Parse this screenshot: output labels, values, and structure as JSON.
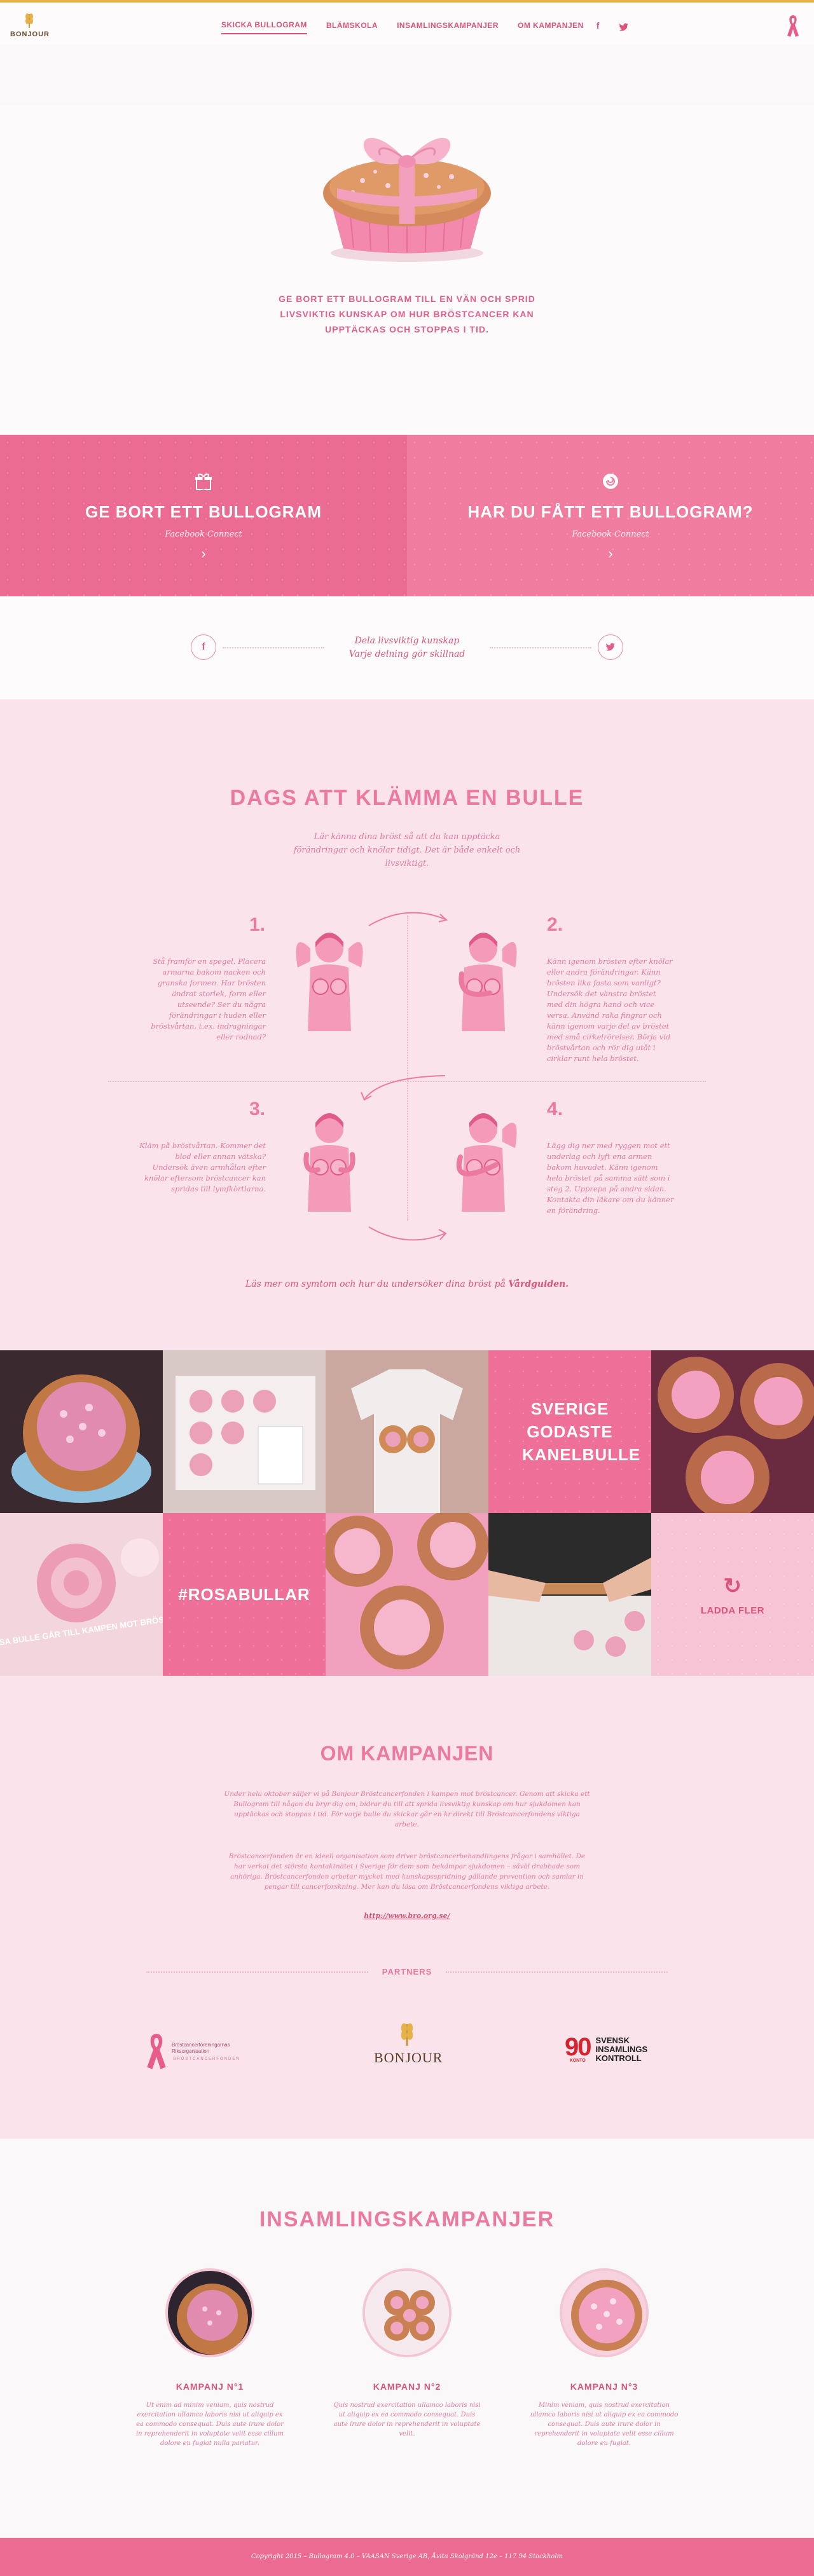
{
  "nav": {
    "logo_text": "BONJOUR",
    "items": [
      "SKICKA BULLOGRAM",
      "BLÄMSKOLA",
      "INSAMLINGSKAMPANJER",
      "OM KAMPANJEN"
    ],
    "facebook_glyph": "f",
    "twitter_glyph": "t"
  },
  "hero": {
    "text": "GE BORT ETT BULLOGRAM TILL EN VÄN OCH SPRID LIVSVIKTIG KUNSKAP OM HUR BRÖSTCANCER KAN UPPTÄCKAS OCH STOPPAS I TID."
  },
  "cta": [
    {
      "title": "GE BORT ETT BULLOGRAM",
      "sub": "Facebook Connect",
      "icon": "gift-icon"
    },
    {
      "title": "HAR DU FÅTT ETT BULLOGRAM?",
      "sub": "Facebook Connect",
      "icon": "bun-icon"
    }
  ],
  "share": {
    "line1": "Dela livsviktig kunskap",
    "line2": "Varje delning gör skillnad"
  },
  "squeeze": {
    "title": "DAGS ATT KLÄMMA EN BULLE",
    "intro": "Lär känna dina bröst så att du kan upptäcka förändringar och knölar tidigt. Det är både enkelt och livsviktigt.",
    "steps": [
      {
        "num": "1.",
        "text": "Stå framför en spegel. Placera armarna bakom nacken och granska formen. Har brösten ändrat storlek, form eller utseende? Ser du några förändringar i huden eller bröstvårtan, t.ex. indragningar eller rodnad?"
      },
      {
        "num": "2.",
        "text": "Känn igenom brösten efter knölar eller andra förändringar. Känn brösten lika fasta som vanligt? Undersök det vänstra bröstet med din högra hand och vice versa. Använd raka fingrar och känn igenom varje del av bröstet med små cirkelrörelser. Börja vid bröstvårtan och rör dig utåt i cirklar runt hela bröstet."
      },
      {
        "num": "3.",
        "text": "Kläm på bröstvårtan. Kommer det blod eller annan vätska? Undersök även armhålan efter knölar eftersom bröstcancer kan spridas till lymfkörtlarna."
      },
      {
        "num": "4.",
        "text": "Lägg dig ner med ryggen mot ett underlag och lyft ena armen bakom huvudet. Känn igenom hela bröstet på samma sätt som i steg 2. Upprepa på andra sidan. Kontakta din läkare om du känner en förändring."
      }
    ],
    "guide_pre": "Läs mer om symtom och hur du undersöker dina bröst på",
    "guide_link": "Vårdguiden."
  },
  "gallery": {
    "tile_text_1": "SVERIGE GODASTE KANELBULLE",
    "tile_text_2": "#ROSABULLAR",
    "load_more": "LADDA FLER",
    "photo_caption": "VARJE ROSA BULLE GÅR TILL KAMPEN MOT BRÖSTCANCER"
  },
  "about": {
    "title": "OM KAMPANJEN",
    "p1": "Under hela oktober säljer vi på Bonjour Bröstcancerfonden i kampen mot bröstcancer. Genom att skicka ett Bullogram till någon du bryr dig om, bidrar du till att sprida livsviktig kunskap om hur sjukdomen kan upptäckas och stoppas i tid. För varje bulle du skickar går en kr direkt till Bröstcancerfondens viktiga arbete.",
    "p2": "Bröstcancerfonden är en ideell organisation som driver bröstcancerbehandlingens frågor i samhället. De har verkat det största kontaktnätet i Sverige för dem som bekämpar sjukdomen – såväl drabbade som anhöriga. Bröstcancerfonden arbetar mycket med kunskapsspridning gällande prevention och samlar in pengar till cancerforskning. Mer kan du läsa om Bröstcancerfondens viktiga arbete.",
    "link": "http://www.bro.org.se/",
    "partners_label": "PARTNERS",
    "partner1_name": "Bröstcancerföreningarnas Riksorganisation",
    "partner1_small": "BRÖSTCANCERFONDEN",
    "partner2_name": "BONJOUR",
    "partner3_num": "90",
    "partner3_konto": "KONTO",
    "partner3_name_1": "SVENSK",
    "partner3_name_2": "INSAMLINGS",
    "partner3_name_3": "KONTROLL"
  },
  "campaigns": {
    "title": "INSAMLINGSKAMPANJER",
    "items": [
      {
        "name": "KAMPANJ N°1",
        "text": "Ut enim ad minim veniam, quis nostrud exercitation ullamco laboris nisi ut aliquip ex ea commodo consequat. Duis aute irure dolor in reprehenderit in voluptate velit esse cillum dolore eu fugiat nulla pariatur."
      },
      {
        "name": "KAMPANJ N°2",
        "text": "Quis nostrud exercitation ullamco laboris nisi ut aliquip ex ea commodo consequat. Duis aute irure dolor in reprehenderit in voluptate velit."
      },
      {
        "name": "KAMPANJ N°3",
        "text": "Minim veniam, quis nostrud exercitation ullamco laboris nisi ut aliquip ex ea commodo consequat. Duis aute irure dolor in reprehenderit in voluptate velit esse cillum dolore eu fugiat."
      }
    ]
  },
  "footer": {
    "text": "Copyright 2015 – Bullogram 4.0 – VAASAN Sverige AB, Åvita Skolgränd 12e – 117 94 Stockholm"
  },
  "colors": {
    "accent": "#ec6b93",
    "text": "#d9547a",
    "light_bg": "#fbe3ec",
    "gold": "#e5b24a"
  }
}
